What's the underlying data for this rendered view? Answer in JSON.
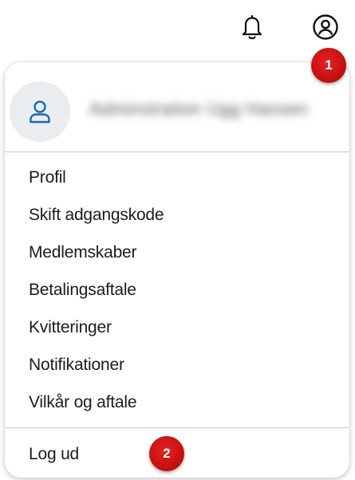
{
  "header": {
    "notification_icon": "bell-icon",
    "account_icon": "account-circle-icon"
  },
  "user_menu": {
    "avatar_icon": "user-icon",
    "user_name": "Adminstration Ugg Hansen",
    "items": [
      {
        "label": "Profil"
      },
      {
        "label": "Skift adgangskode"
      },
      {
        "label": "Medlemskaber"
      },
      {
        "label": "Betalingsaftale"
      },
      {
        "label": "Kvitteringer"
      },
      {
        "label": "Notifikationer"
      },
      {
        "label": "Vilkår og aftale"
      }
    ],
    "logout_label": "Log ud"
  },
  "annotations": {
    "badge_1": "1",
    "badge_2": "2"
  },
  "colors": {
    "accent": "#1a6aa8",
    "badge": "#c50f0f",
    "avatar_bg": "#e9edf0",
    "divider": "#c9c9c9"
  }
}
